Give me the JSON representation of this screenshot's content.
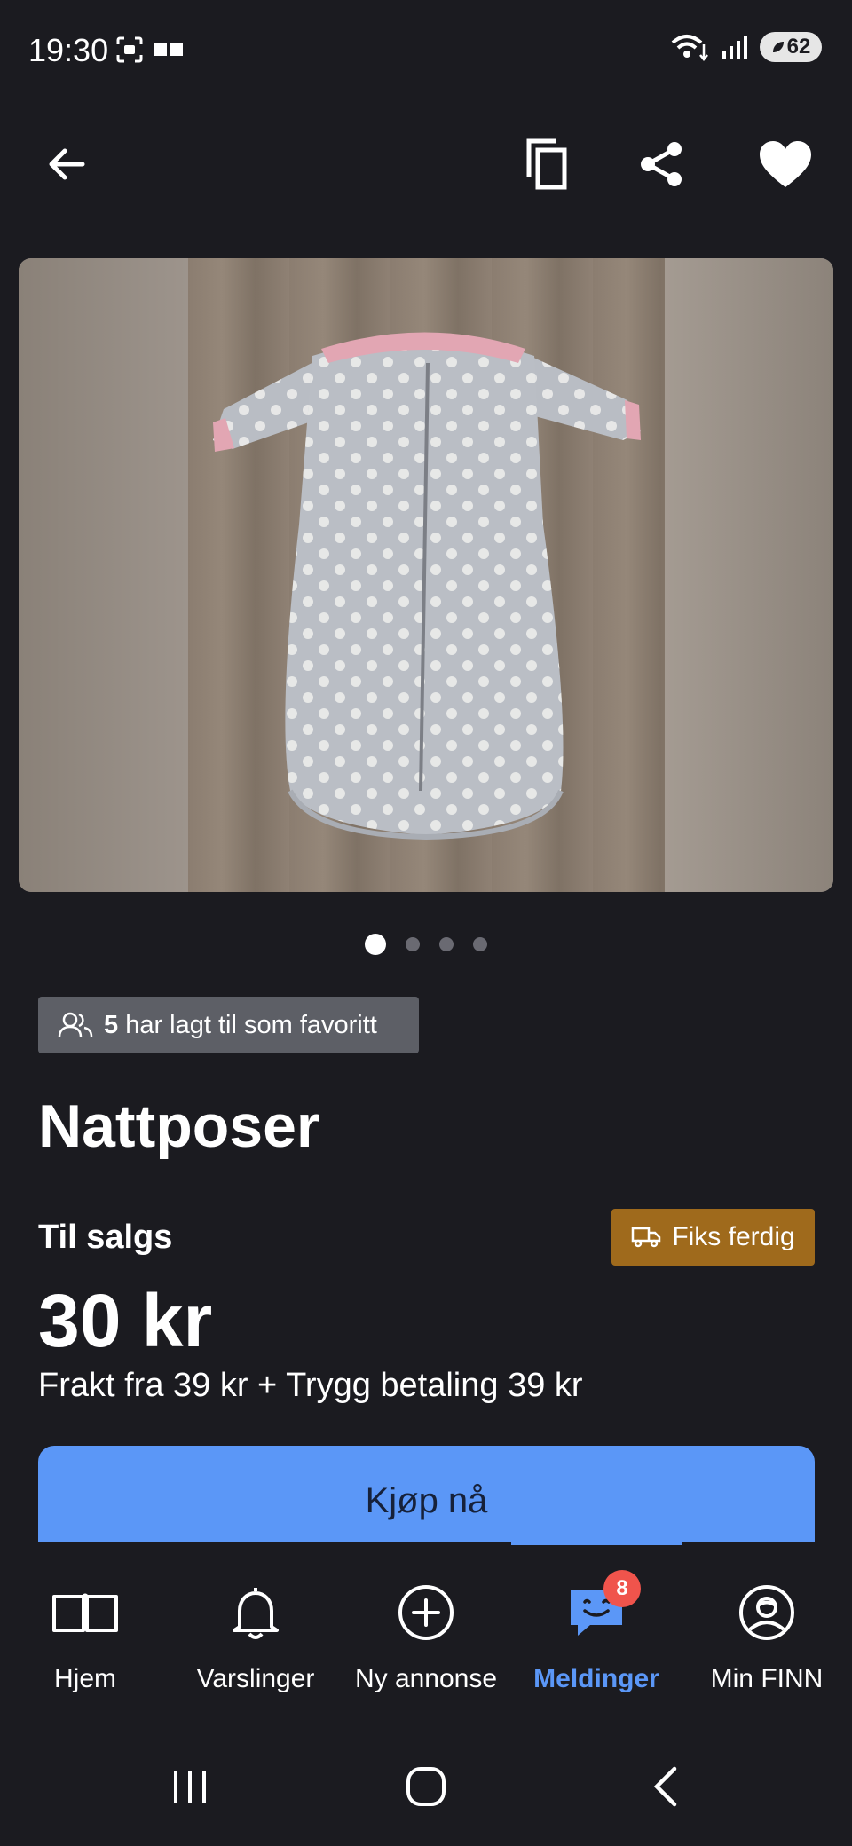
{
  "status_bar": {
    "time": "19:30",
    "battery": "62"
  },
  "listing": {
    "favorites_count": "5",
    "favorites_text": "har lagt til som favoritt",
    "title": "Nattposer",
    "sale_type": "Til salgs",
    "fiks_ferdig_label": "Fiks ferdig",
    "price": "30 kr",
    "shipping": "Frakt fra 39 kr + Trygg betaling 39 kr",
    "buy_label": "Kjøp nå",
    "image_count": 4,
    "image_index": 1
  },
  "bottom_nav": {
    "items": [
      {
        "label": "Hjem",
        "icon": "book-icon"
      },
      {
        "label": "Varslinger",
        "icon": "bell-icon"
      },
      {
        "label": "Ny annonse",
        "icon": "plus-circle-icon"
      },
      {
        "label": "Meldinger",
        "icon": "chat-icon",
        "badge": "8",
        "active": true
      },
      {
        "label": "Min FINN",
        "icon": "profile-icon"
      }
    ]
  },
  "colors": {
    "background": "#1b1b20",
    "accent": "#5b97f7",
    "fiks_badge": "#9f6a1c",
    "fav_badge": "#5d5f66",
    "notification": "#f0544c"
  }
}
